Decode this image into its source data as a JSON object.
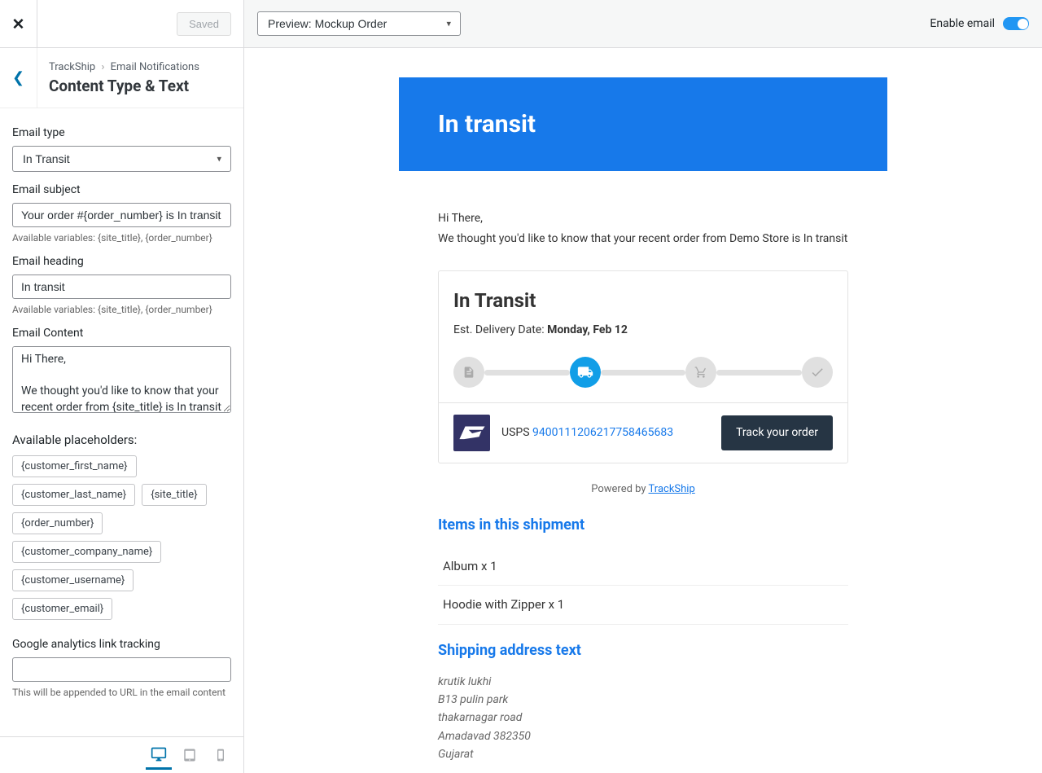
{
  "topBar": {
    "savedLabel": "Saved"
  },
  "breadcrumb": {
    "root": "TrackShip",
    "page": "Email Notifications",
    "title": "Content Type & Text"
  },
  "form": {
    "emailTypeLabel": "Email type",
    "emailTypeValue": "In Transit",
    "emailSubjectLabel": "Email subject",
    "emailSubjectValue": "Your order #{order_number} is In transit",
    "varsHelp": "Available variables: {site_title}, {order_number}",
    "emailHeadingLabel": "Email heading",
    "emailHeadingValue": "In transit",
    "emailContentLabel": "Email Content",
    "emailContentValue": "Hi There,\n\nWe thought you'd like to know that your recent order from {site_title} is In transit",
    "placeholdersTitle": "Available placeholders:",
    "placeholders": [
      "{customer_first_name}",
      "{customer_last_name}",
      "{site_title}",
      "{order_number}",
      "{customer_company_name}",
      "{customer_username}",
      "{customer_email}"
    ],
    "gaLabel": "Google analytics link tracking",
    "gaValue": "",
    "gaHelp": "This will be appended to URL in the email content"
  },
  "previewBar": {
    "selectValue": "Preview: Mockup Order",
    "enableLabel": "Enable email"
  },
  "email": {
    "headerTitle": "In transit",
    "greeting": "Hi There,",
    "intro": "We thought you'd like to know that your recent order from Demo Store is In transit",
    "status": "In Transit",
    "estLabel": "Est. Delivery Date: ",
    "estDate": "Monday, Feb 12",
    "carrier": "USPS",
    "trackingNumber": "9400111206217758465683",
    "trackBtn": "Track your order",
    "poweredBy": "Powered by ",
    "poweredLink": "TrackShip",
    "itemsTitle": "Items in this shipment",
    "items": [
      "Album x 1",
      "Hoodie with Zipper x 1"
    ],
    "addrTitle": "Shipping address text",
    "addr": [
      "krutik lukhi",
      "B13 pulin park",
      "thakarnagar road",
      "Amadavad 382350",
      "Gujarat"
    ]
  }
}
